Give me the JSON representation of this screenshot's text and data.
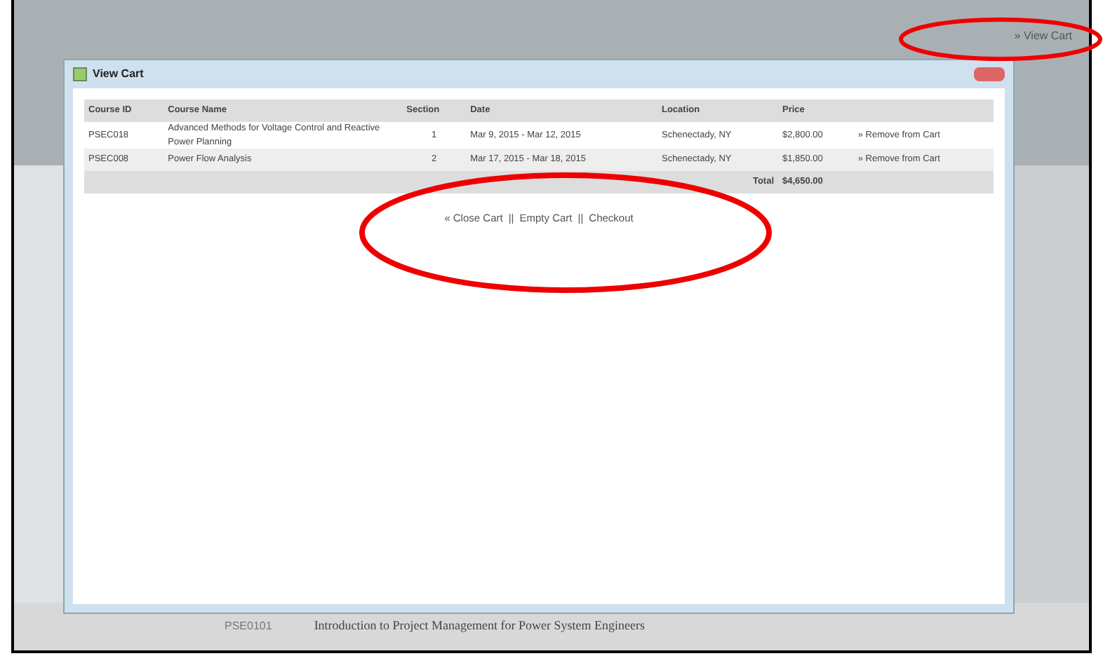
{
  "header_link": "» View Cart",
  "dialog": {
    "title": "View Cart",
    "table": {
      "columns": [
        "Course ID",
        "Course Name",
        "Section",
        "Date",
        "Location",
        "Price"
      ],
      "rows": [
        {
          "course_id": "PSEC018",
          "course_name": "Advanced Methods for Voltage Control and Reactive Power Planning",
          "section": "1",
          "date": "Mar 9, 2015 - Mar 12, 2015",
          "location": "Schenectady, NY",
          "price": "$2,800.00",
          "action": "» Remove from Cart"
        },
        {
          "course_id": "PSEC008",
          "course_name": "Power Flow Analysis",
          "section": "2",
          "date": "Mar 17, 2015 - Mar 18, 2015",
          "location": "Schenectady, NY",
          "price": "$1,850.00",
          "action": "» Remove from Cart"
        }
      ],
      "total_label": "Total",
      "total": "$4,650.00"
    },
    "links": [
      "« Close Cart",
      "Empty Cart",
      "Checkout"
    ],
    "separator": "||"
  },
  "background_row": {
    "course_id": "PSE0101",
    "course_name": "Introduction to Project Management for Power System Engineers"
  }
}
